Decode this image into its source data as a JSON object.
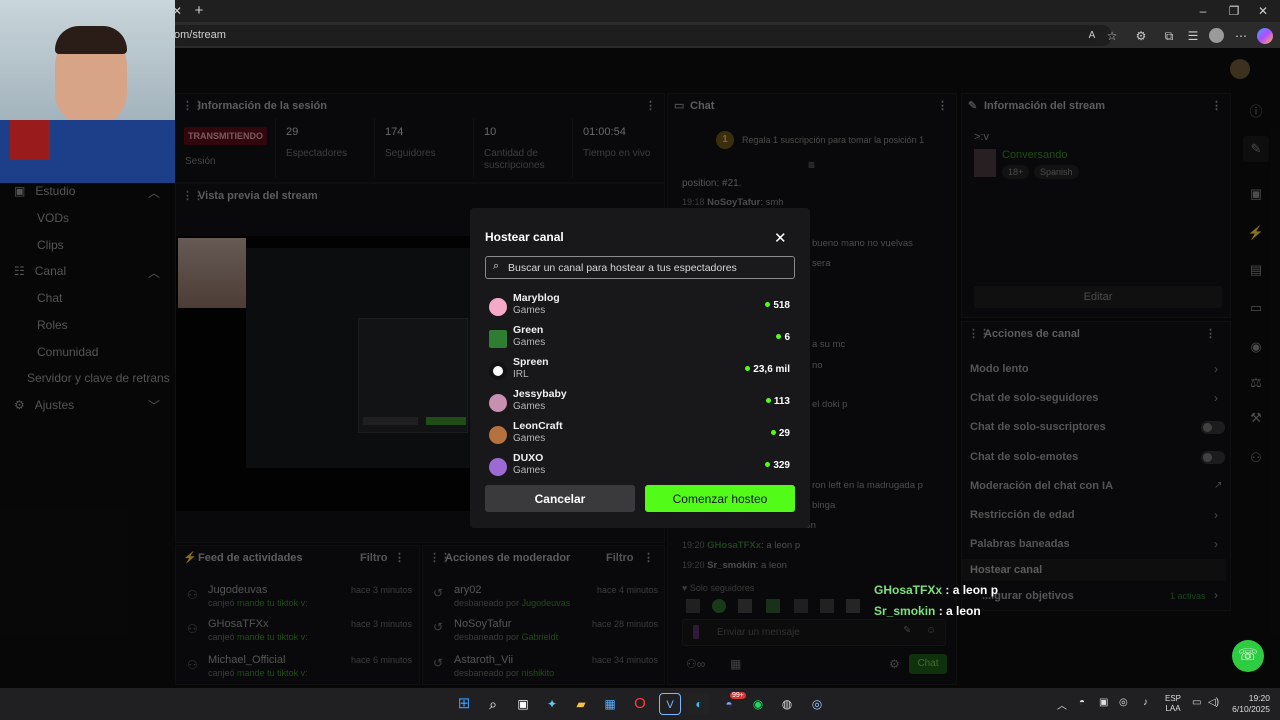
{
  "browser": {
    "url": "om/stream",
    "new_tab": "+",
    "controls": [
      "–",
      "❐",
      "✕"
    ]
  },
  "session_panel": {
    "title": "Información de la sesión",
    "live_badge": "TRANSMITIENDO",
    "session_label": "Sesión",
    "stats": [
      {
        "value": "29",
        "label": "Espectadores"
      },
      {
        "value": "174",
        "label": "Seguidores"
      },
      {
        "value": "10",
        "label": "Cantidad de suscripciones"
      },
      {
        "value": "01:00:54",
        "label": "Tiempo en vivo"
      }
    ]
  },
  "preview_panel": {
    "title": "Vista previa del stream"
  },
  "sidebar": {
    "items": [
      {
        "label": "Estudio",
        "type": "section"
      },
      {
        "label": "VODs",
        "type": "item"
      },
      {
        "label": "Clips",
        "type": "item"
      },
      {
        "label": "Canal",
        "type": "section"
      },
      {
        "label": "Chat",
        "type": "item"
      },
      {
        "label": "Roles",
        "type": "item"
      },
      {
        "label": "Comunidad",
        "type": "item"
      },
      {
        "label": "Servidor y clave de retrans",
        "type": "item"
      },
      {
        "label": "Ajustes",
        "type": "section"
      }
    ]
  },
  "chat_panel": {
    "title": "Chat",
    "gift_text": "Regala 1 suscripción para tomar la posición 1",
    "gift_rank": "1",
    "position_text": "position: #21.",
    "messages": [
      {
        "time": "19:18",
        "user": "NoSoyTafur",
        "text": "smh"
      },
      {
        "time": "19:20",
        "user": "GHosaTFXx",
        "text": "a leon p"
      },
      {
        "time": "",
        "user": "Sr_smokin",
        "text": "a leon"
      }
    ],
    "fragments": [
      "bueno mano no vuelvas",
      "sera",
      "a su mc",
      "no",
      "el doki p",
      "ron left en la madrugada p",
      "binga",
      "non"
    ],
    "followers_only": "Solo seguidores",
    "input_placeholder": "Enviar un mensaje",
    "send_label": "Chat"
  },
  "stream_info_panel": {
    "title": "Información del stream",
    "stream_title": ">:v",
    "category": "Conversando",
    "tags": [
      "18+",
      "Spanish"
    ],
    "edit_label": "Editar"
  },
  "channel_actions": {
    "title": "Acciones de canal",
    "items": [
      {
        "label": "Modo lento",
        "control": "chevron"
      },
      {
        "label": "Chat de solo-seguidores",
        "control": "chevron"
      },
      {
        "label": "Chat de solo-suscriptores",
        "control": "toggle"
      },
      {
        "label": "Chat de solo-emotes",
        "control": "toggle"
      },
      {
        "label": "Moderación del chat con IA",
        "control": "external"
      },
      {
        "label": "Restricción de edad",
        "control": "chevron"
      },
      {
        "label": "Palabras baneadas",
        "control": "chevron"
      },
      {
        "label": "Hostear canal",
        "control": "none"
      },
      {
        "label": "...igurar objetivos",
        "control": "chevron",
        "extra": "1 activas"
      }
    ]
  },
  "activity_feed": {
    "title": "Feed de actividades",
    "filter_label": "Filtro",
    "items": [
      {
        "user": "Jugodeuvas",
        "time": "hace 3 minutos",
        "desc": "canjeó",
        "reward": "mande tu tiktok v:"
      },
      {
        "user": "GHosaTFXx",
        "time": "hace 3 minutos",
        "desc": "canjeó",
        "reward": "mande tu tiktok v:"
      },
      {
        "user": "Michael_Official",
        "time": "hace 6 minutos",
        "desc": "canjeó",
        "reward": "mande tu tiktok v:"
      }
    ]
  },
  "mod_actions": {
    "title": "Acciones de moderador",
    "filter_label": "Filtro",
    "items": [
      {
        "user": "ary02",
        "time": "hace 4 minutos",
        "desc": "desbaneado por",
        "by": "Jugodeuvas"
      },
      {
        "user": "NoSoyTafur",
        "time": "hace 28 minutos",
        "desc": "desbaneado por",
        "by": "Gabrieldt"
      },
      {
        "user": "Astaroth_Vii",
        "time": "hace 34 minutos",
        "desc": "desbaneado por",
        "by": "nishikito"
      }
    ]
  },
  "host_modal": {
    "title": "Hostear canal",
    "search_placeholder": "Buscar un canal para hostear a tus espectadores",
    "channels": [
      {
        "name": "Maryblog",
        "category": "Games",
        "viewers": "518",
        "avatar_color": "#f4a9c8"
      },
      {
        "name": "Green",
        "category": "Games",
        "viewers": "6",
        "avatar_color": "#2e7d32"
      },
      {
        "name": "Spreen",
        "category": "IRL",
        "viewers": "23,6 mil",
        "avatar_color": "#ffffff"
      },
      {
        "name": "Jessybaby",
        "category": "Games",
        "viewers": "113",
        "avatar_color": "#c78fb0"
      },
      {
        "name": "LeonCraft",
        "category": "Games",
        "viewers": "29",
        "avatar_color": "#b5723e"
      },
      {
        "name": "DUXO",
        "category": "Games",
        "viewers": "329",
        "avatar_color": "#9b6bd3"
      }
    ],
    "cancel_label": "Cancelar",
    "start_label": "Comenzar hosteo"
  },
  "overlay_chat": [
    {
      "user": "GHosaTFXx",
      "text": ": a leon p"
    },
    {
      "user": "Sr_smokin",
      "text": ": a leon"
    }
  ],
  "taskbar": {
    "lang": "ESP",
    "lang2": "LAA",
    "time": "19:20",
    "date": "6/10/2025",
    "badge": "99+"
  },
  "colors": {
    "accent": "#53fc18",
    "live_badge": "#c0142b",
    "panel": "#121214"
  }
}
